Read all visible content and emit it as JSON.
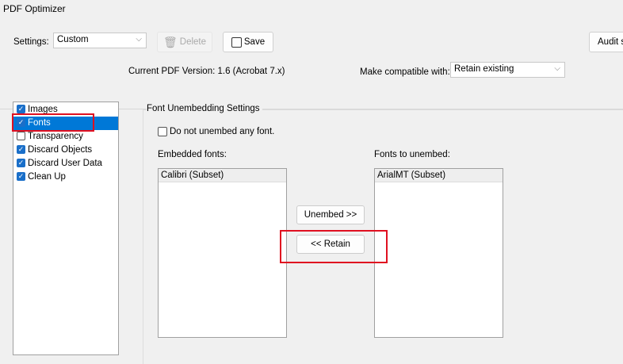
{
  "window": {
    "title": "PDF Optimizer"
  },
  "toolbar": {
    "settings_label": "Settings:",
    "settings_value": "Custom",
    "delete_label": "Delete",
    "save_label": "Save",
    "audit_label": "Audit s"
  },
  "version": {
    "current": "Current PDF Version: 1.6 (Acrobat 7.x)",
    "compat_label": "Make compatible with:",
    "compat_value": "Retain existing"
  },
  "sidebar": {
    "items": [
      {
        "label": "Images",
        "checked": true
      },
      {
        "label": "Fonts",
        "checked": true
      },
      {
        "label": "Transparency",
        "checked": false
      },
      {
        "label": "Discard Objects",
        "checked": true
      },
      {
        "label": "Discard User Data",
        "checked": true
      },
      {
        "label": "Clean Up",
        "checked": true
      }
    ]
  },
  "fonts": {
    "group_title": "Font Unembedding Settings",
    "no_unembed_label": "Do not unembed any font.",
    "embedded_label": "Embedded fonts:",
    "embedded": [
      "Calibri (Subset)"
    ],
    "unembed_label": "Fonts to unembed:",
    "to_unembed": [
      "ArialMT (Subset)"
    ],
    "unembed_button": "Unembed >>",
    "retain_button": "<< Retain"
  }
}
